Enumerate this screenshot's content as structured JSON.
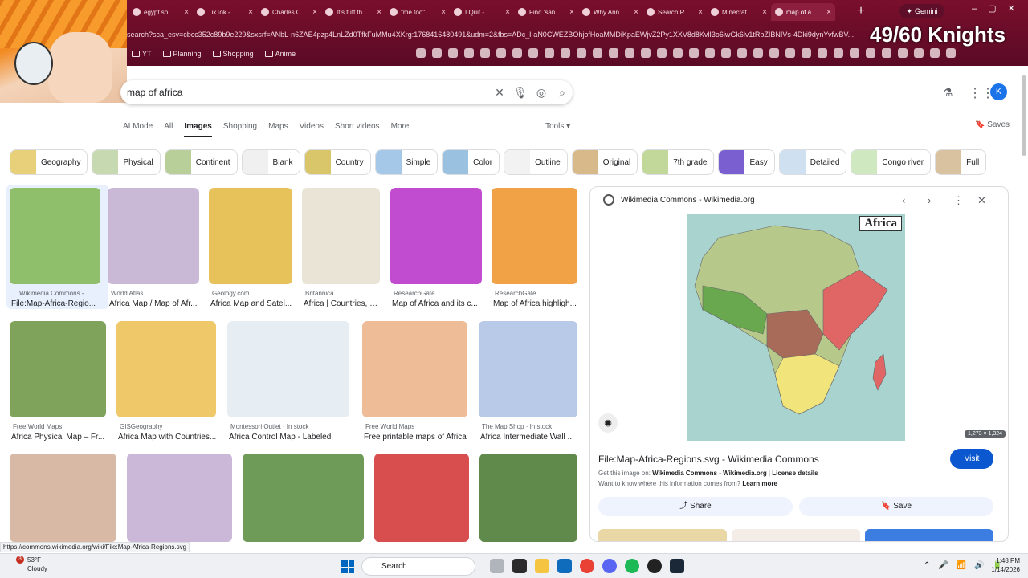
{
  "browser": {
    "tabs": [
      {
        "label": "egypt so",
        "active": false
      },
      {
        "label": "TikTok -",
        "active": false
      },
      {
        "label": "Charles C",
        "active": false
      },
      {
        "label": "It's tuff th",
        "active": false
      },
      {
        "label": "\"me too\"",
        "active": false
      },
      {
        "label": "I Quit -",
        "active": false
      },
      {
        "label": "Find 'san",
        "active": false
      },
      {
        "label": "Why Ann",
        "active": false
      },
      {
        "label": "Search R",
        "active": false
      },
      {
        "label": "Minecraf",
        "active": false
      },
      {
        "label": "map of a",
        "active": true
      }
    ],
    "gemini_label": "Gemini",
    "address": "search?sca_esv=cbcc352c89b9e229&sxsrf=ANbL-n6ZAE4pzp4LnLZd0TfkFuMMu4XKrg:1768416480491&udm=2&fbs=ADc_l-aN0CWEZBOhjofHoaMMDiKpaEWjvZ2Py1XXV8d8KvlI3o6iwGk6lv1tRbZIBNIVs-4Dki9dynYvfwBV...",
    "overlay_text": "49/60 Knights",
    "bookmarks": [
      "YT",
      "Planning",
      "Shopping",
      "Anime"
    ],
    "status_url": "https://commons.wikimedia.org/wiki/File:Map-Africa-Regions.svg"
  },
  "search": {
    "query": "map of africa",
    "account_initial": "K",
    "modes": [
      "AI Mode",
      "All",
      "Images",
      "Shopping",
      "Maps",
      "Videos",
      "Short videos",
      "More"
    ],
    "selected_mode": "Images",
    "tools_label": "Tools",
    "saves_label": "Saves",
    "chips": [
      "Geography",
      "Physical",
      "Continent",
      "Blank",
      "Country",
      "Simple",
      "Color",
      "Outline",
      "Original",
      "7th grade",
      "Easy",
      "Detailed",
      "Congo river",
      "Full"
    ]
  },
  "results": [
    {
      "source": "Wikimedia Commons - ...",
      "caption": "File:Map-Africa-Regio...",
      "color": "#8fbf6a"
    },
    {
      "source": "World Atlas",
      "caption": "Africa Map / Map of Afr...",
      "color": "#c9b8d6"
    },
    {
      "source": "Geology.com",
      "caption": "Africa Map and Satel...",
      "color": "#e7c15a"
    },
    {
      "source": "Britannica",
      "caption": "Africa | Countries, R...",
      "color": "#e9e4d6"
    },
    {
      "source": "ResearchGate",
      "caption": "Map of Africa and its c...",
      "color": "#c14ccf"
    },
    {
      "source": "ResearchGate",
      "caption": "Map of Africa highligh...",
      "color": "#f2a246"
    },
    {
      "source": "Free World Maps",
      "caption": "Africa Physical Map – Fr...",
      "color": "#7fa35a"
    },
    {
      "source": "GISGeography",
      "caption": "Africa Map with Countries...",
      "color": "#efc86a"
    },
    {
      "source": "Montessori Outlet · In stock",
      "caption": "Africa Control Map - Labeled",
      "color": "#e6eef3"
    },
    {
      "source": "Free World Maps",
      "caption": "Free printable maps of Africa",
      "color": "#eebd98"
    },
    {
      "source": "The Map Shop · In stock",
      "caption": "Africa Intermediate Wall ...",
      "color": "#b9c9e8"
    },
    {
      "source": "",
      "caption": "",
      "color": "#d7b9a6"
    },
    {
      "source": "",
      "caption": "",
      "color": "#cbb8d9"
    },
    {
      "source": "",
      "caption": "",
      "color": "#6f9b58"
    },
    {
      "source": "",
      "caption": "",
      "color": "#d84d4d"
    },
    {
      "source": "",
      "caption": "",
      "color": "#5f8a4b"
    }
  ],
  "panel": {
    "site": "Wikimedia Commons - Wikimedia.org",
    "map_title": "Africa",
    "dimensions": "1,273 × 1,324",
    "title": "File:Map-Africa-Regions.svg - Wikimedia Commons",
    "visit_label": "Visit",
    "get_image_prefix": "Get this image on:",
    "get_image_site": "Wikimedia Commons - Wikimedia.org",
    "license_label": "License details",
    "know_prefix": "Want to know where this information comes from?",
    "learn_more": "Learn more",
    "share_label": "Share",
    "save_label": "Save"
  },
  "taskbar": {
    "temp": "53°F",
    "condition": "Cloudy",
    "weather_badge": "3",
    "search_label": "Search",
    "time": "1:48 PM",
    "date": "1/14/2026"
  }
}
